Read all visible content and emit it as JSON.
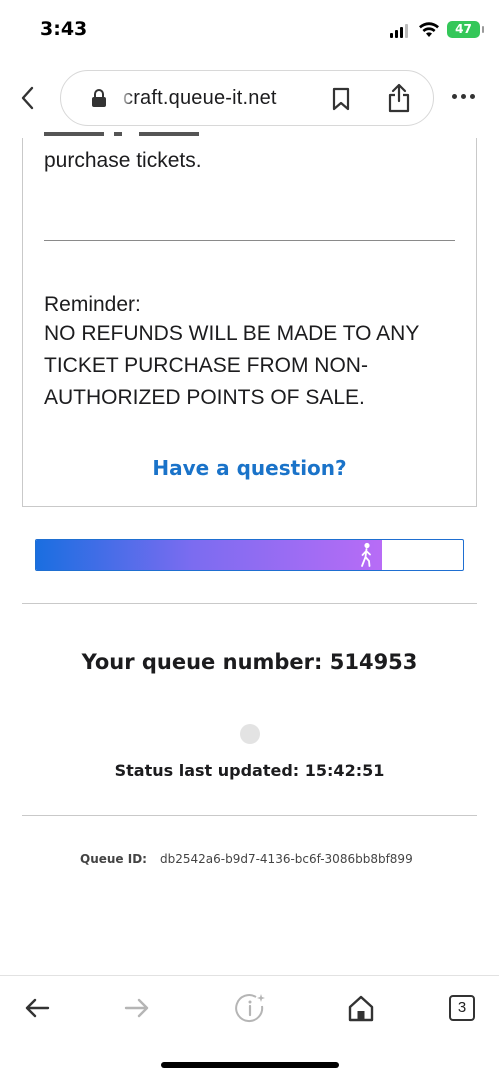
{
  "status_bar": {
    "time": "3:43",
    "battery": "47"
  },
  "browser": {
    "url": "craft.queue-it.net",
    "tabs_count": "3"
  },
  "card": {
    "paragraph_end": "purchase tickets.",
    "reminder_label": "Reminder:",
    "notice_text": "NO REFUNDS WILL BE MADE TO ANY TICKET PURCHASE FROM NON-AUTHORIZED POINTS OF SALE.",
    "question_link": "Have a question?"
  },
  "queue": {
    "progress_fraction": 0.81,
    "queue_number_text": "Your queue number: 514953",
    "status_updated_text": "Status last updated: 15:42:51",
    "queue_id_label": "Queue ID:",
    "queue_id_value": "db2542a6-b9d7-4136-bc6f-3086bb8bf899"
  },
  "colors": {
    "link": "#1a73c9",
    "progress_start": "#1a6ee0",
    "progress_end": "#b86cf6",
    "battery": "#34c759"
  },
  "icons": [
    "lock-icon",
    "bookmark-icon",
    "share-icon",
    "more-icon",
    "back-icon",
    "forward-icon",
    "info-sparkle-icon",
    "home-icon",
    "tabs-icon",
    "walker-icon"
  ]
}
